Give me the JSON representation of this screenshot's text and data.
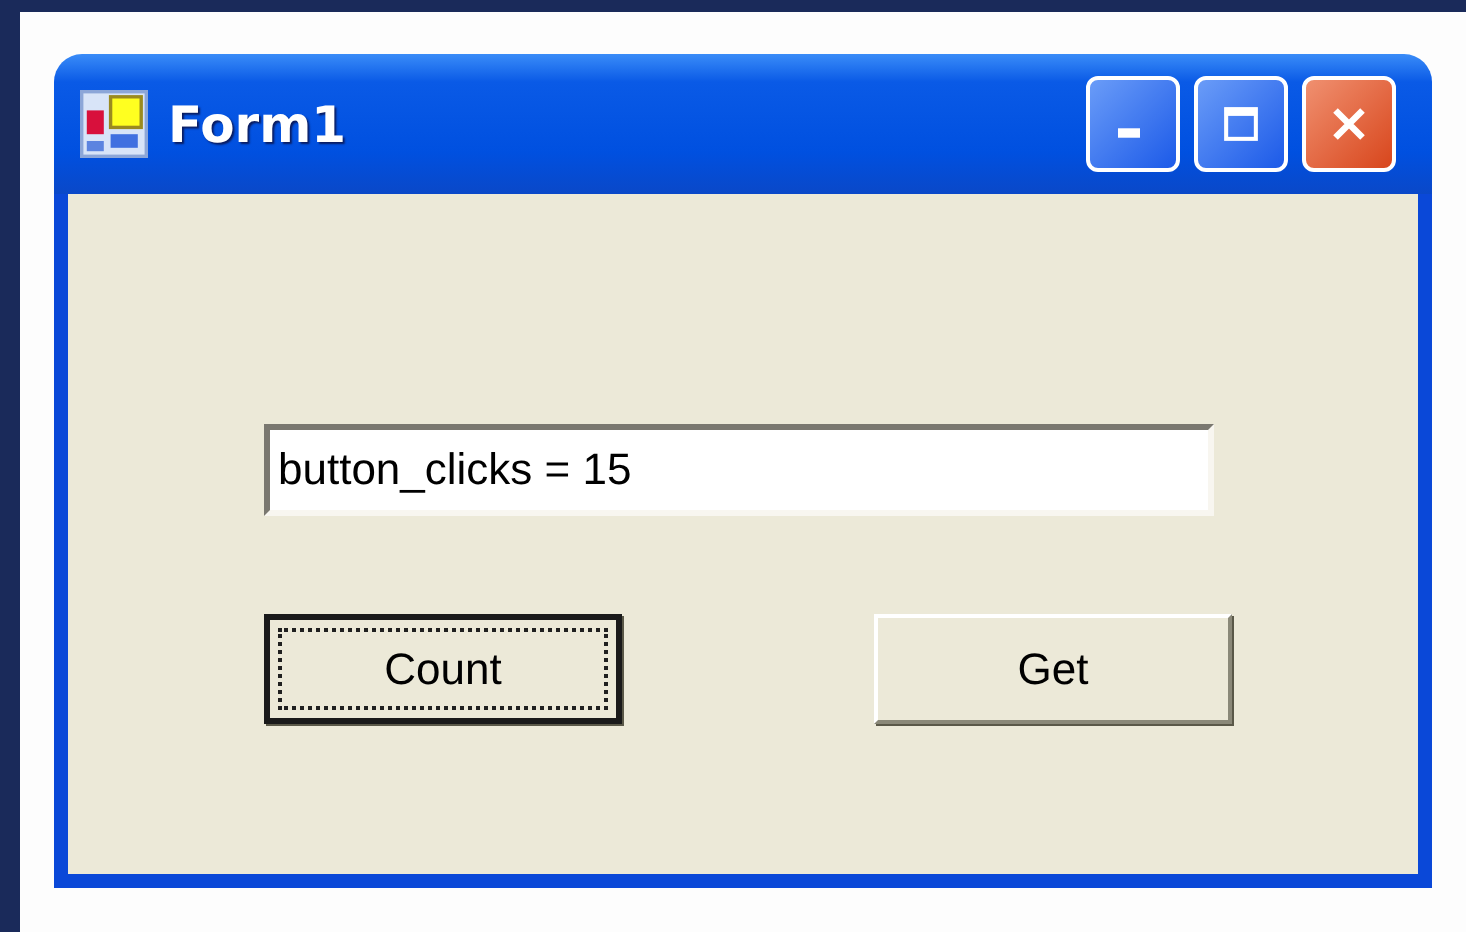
{
  "window": {
    "title": "Form1"
  },
  "textbox": {
    "value": "button_clicks = 15"
  },
  "buttons": [
    {
      "label": "Count",
      "focused": true
    },
    {
      "label": "Get",
      "focused": false
    }
  ]
}
